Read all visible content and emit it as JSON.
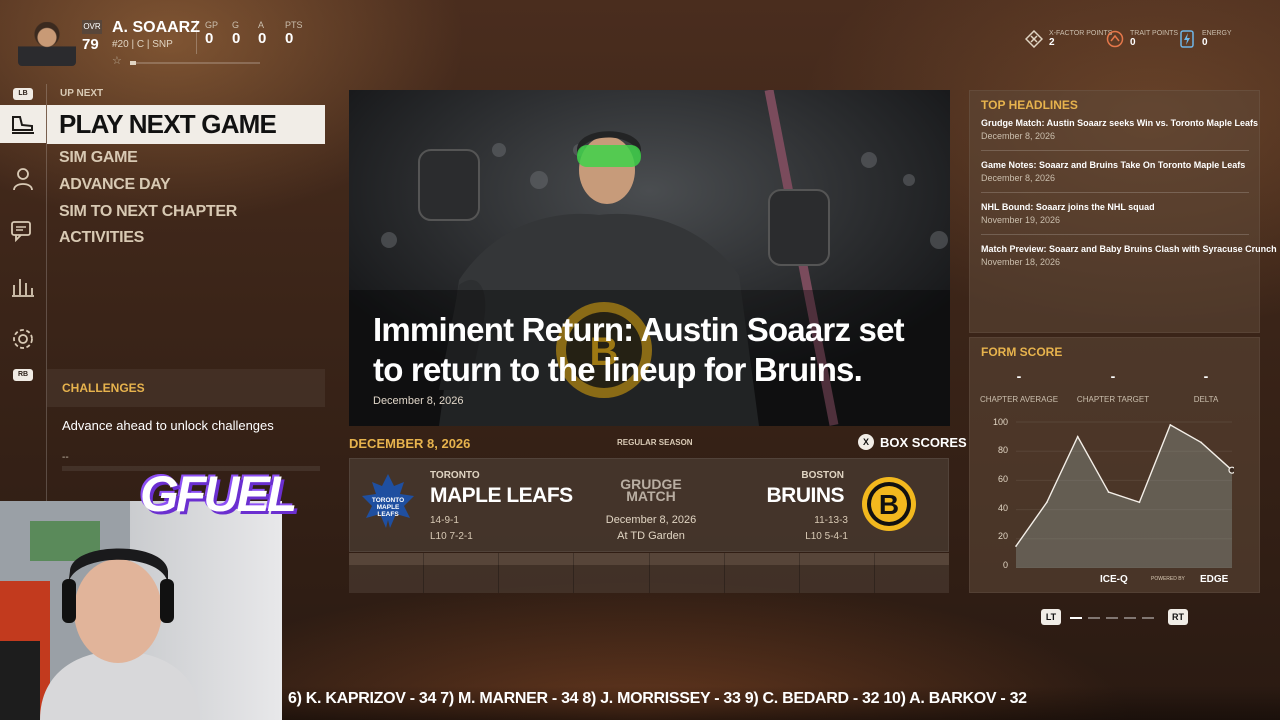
{
  "player": {
    "ovr_label": "OVR",
    "ovr": "79",
    "name": "A. SOAARZ",
    "info": "#20 | C | SNP",
    "stats": [
      {
        "label": "GP",
        "value": "0"
      },
      {
        "label": "G",
        "value": "0"
      },
      {
        "label": "A",
        "value": "0"
      },
      {
        "label": "PTS",
        "value": "0"
      }
    ]
  },
  "points": [
    {
      "label": "X-FACTOR POINTS",
      "value": "2",
      "icon": "x-factor-icon"
    },
    {
      "label": "TRAIT POINTS",
      "value": "0",
      "icon": "trait-icon"
    },
    {
      "label": "ENERGY",
      "value": "0",
      "icon": "energy-icon"
    }
  ],
  "nav": {
    "lb": "LB",
    "rb": "RB",
    "up_next": "UP NEXT",
    "primary": "PLAY NEXT GAME",
    "items": [
      "SIM GAME",
      "ADVANCE DAY",
      "SIM TO NEXT CHAPTER",
      "ACTIVITIES"
    ]
  },
  "challenges": {
    "title": "CHALLENGES",
    "text": "Advance ahead to unlock challenges",
    "dash1": "--",
    "dash2": "--"
  },
  "hero": {
    "title": "Imminent Return: Austin Soaarz set to return to the lineup for Bruins.",
    "date": "December 8, 2026"
  },
  "game": {
    "date": "DECEMBER 8, 2026",
    "season": "REGULAR SEASON",
    "box_key": "X",
    "box_label": "BOX SCORES",
    "home": {
      "city": "TORONTO",
      "name": "MAPLE LEAFS",
      "record": "14-9-1",
      "l10": "L10 7-2-1",
      "logo_text": "TORONTO MAPLE LEAFS"
    },
    "away": {
      "city": "BOSTON",
      "name": "BRUINS",
      "record": "11-13-3",
      "l10": "L10 5-4-1",
      "logo_letter": "B"
    },
    "match_type": "GRUDGE MATCH",
    "match_date": "December 8, 2026",
    "venue": "At TD Garden"
  },
  "headlines": {
    "title": "TOP HEADLINES",
    "items": [
      {
        "title": "Grudge Match: Austin Soaarz seeks Win vs. Toronto Maple Leafs",
        "date": "December 8, 2026"
      },
      {
        "title": "Game Notes: Soaarz and Bruins Take On Toronto Maple Leafs",
        "date": "December 8, 2026"
      },
      {
        "title": "NHL Bound: Soaarz joins the NHL squad",
        "date": "November 19, 2026"
      },
      {
        "title": "Match Preview: Soaarz and Baby Bruins Clash with Syracuse Crunch",
        "date": "November 18, 2026"
      }
    ]
  },
  "form": {
    "title": "FORM SCORE",
    "metrics": [
      {
        "label": "CHAPTER AVERAGE",
        "value": "-"
      },
      {
        "label": "CHAPTER TARGET",
        "value": "-"
      },
      {
        "label": "DELTA",
        "value": "-"
      }
    ],
    "brand": "ICE-Q",
    "powered": "POWERED BY",
    "edge": "EDGE",
    "lt": "LT",
    "rt": "RT"
  },
  "chart_data": {
    "type": "area",
    "y_ticks": [
      "100",
      "80",
      "60",
      "40",
      "20",
      "0"
    ],
    "ylim": [
      0,
      100
    ],
    "values": [
      15,
      45,
      90,
      52,
      45,
      98,
      86,
      67
    ]
  },
  "ticker": "6) K. KAPRIZOV - 34   7) M. MARNER - 34   8) J. MORRISSEY - 33   9) C. BEDARD - 32   10) A. BARKOV - 32",
  "sponsor": "GFUEL"
}
